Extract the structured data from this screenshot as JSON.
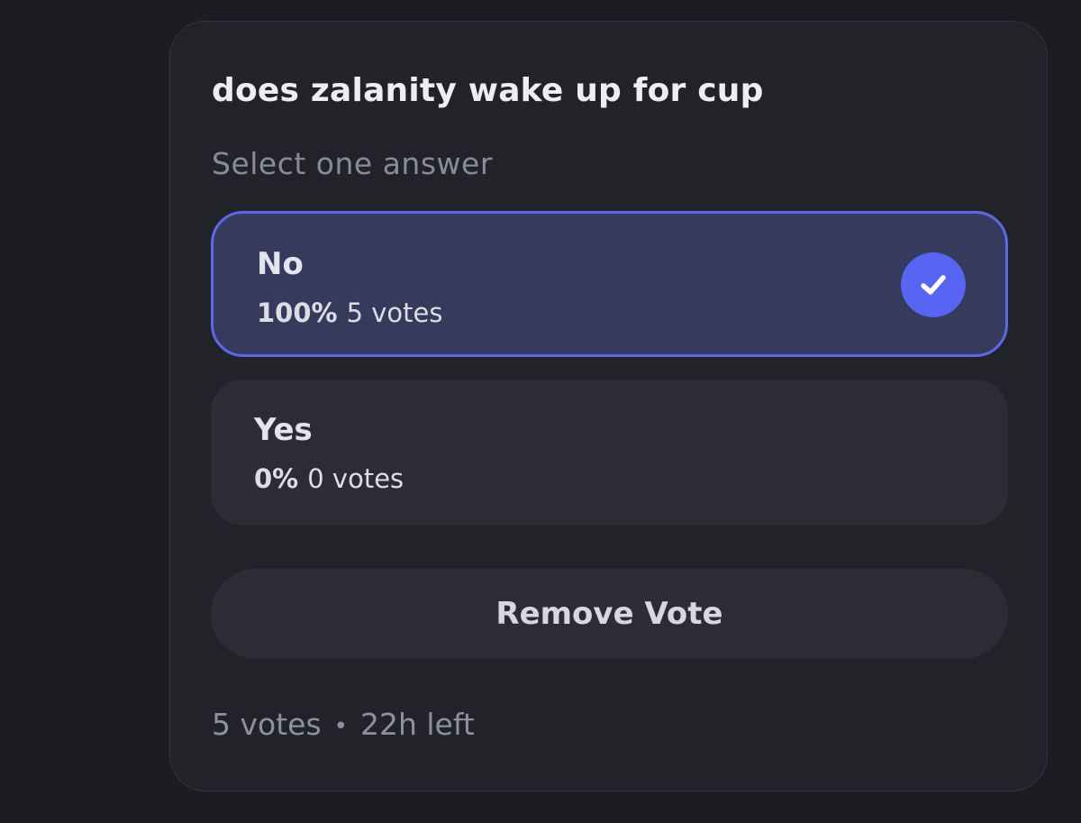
{
  "poll": {
    "question": "does zalanity wake up for cup",
    "subtitle": "Select one answer",
    "options": [
      {
        "label": "No",
        "percent": "100%",
        "votes": "5 votes",
        "selected": true
      },
      {
        "label": "Yes",
        "percent": "0%",
        "votes": "0 votes",
        "selected": false
      }
    ],
    "remove_vote_label": "Remove Vote",
    "footer": {
      "total_votes": "5 votes",
      "separator": "•",
      "time_left": "22h left"
    },
    "icons": {
      "selected_option": "check-circle-icon"
    },
    "colors": {
      "accent": "#5865f2",
      "selected_bg": "#363a5c",
      "card_bg": "#222329",
      "page_bg": "#1c1d23"
    }
  }
}
